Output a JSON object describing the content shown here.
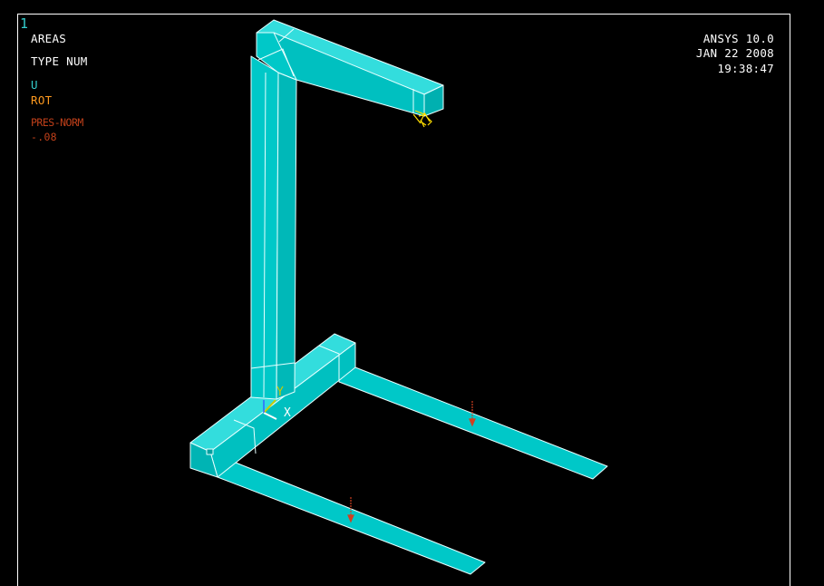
{
  "window": {
    "number": "1"
  },
  "legend": {
    "entity": "AREAS",
    "numbering": "TYPE NUM",
    "constraint_u": "U",
    "constraint_rot": "ROT",
    "pressure_label": "PRES-NORM",
    "pressure_value": "-.08"
  },
  "info": {
    "product": "ANSYS 10.0",
    "date": "JAN 22 2008",
    "time": "19:38:47"
  },
  "triad": {
    "y_label": "Y",
    "x_label": "X"
  },
  "colors": {
    "background": "#000000",
    "area_fill": "#00c8c8",
    "area_top": "#33dddd",
    "edge": "#e8ffff",
    "constraint": "#ffdd00",
    "pressure": "#d04020",
    "triad_y": "#cccc00",
    "triad_x": "#ffffff"
  }
}
